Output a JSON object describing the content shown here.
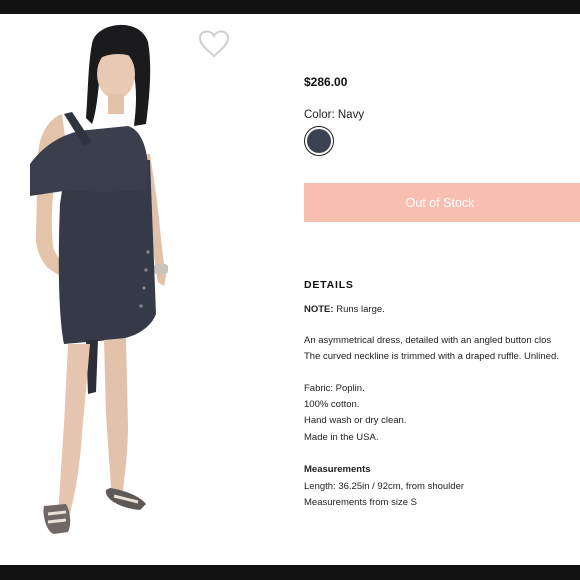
{
  "product": {
    "price": "$286.00",
    "color_label": "Color: Navy",
    "swatch_color": "#3d4252",
    "button_label": "Out of Stock",
    "button_color": "#f8bfb1"
  },
  "details": {
    "heading": "DETAILS",
    "note_label": "NOTE:",
    "note_text": " Runs large.",
    "description_line1": "An asymmetrical        dress, detailed with an angled button clos",
    "description_line2": "The curved neckline is trimmed with a draped ruffle. Unlined.",
    "fabric": "Fabric: Poplin.",
    "content": "100% cotton.",
    "care": "Hand wash or dry clean.",
    "origin": "Made in the USA.",
    "measurements_heading": "Measurements",
    "length": "Length: 36.25in / 92cm, from shoulder",
    "size_note": "Measurements from size S"
  },
  "icons": {
    "wishlist": "heart-outline-icon"
  }
}
